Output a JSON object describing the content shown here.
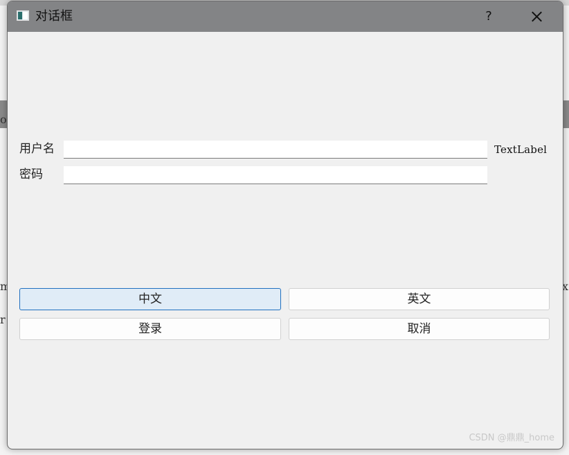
{
  "dialog": {
    "title": "对话框",
    "help_label": "?",
    "close_icon": "close-icon"
  },
  "form": {
    "username_label": "用户名",
    "username_value": "",
    "password_label": "密码",
    "password_value": "",
    "text_label": "TextLabel"
  },
  "buttons": {
    "chinese": "中文",
    "english": "英文",
    "login": "登录",
    "cancel": "取消"
  },
  "background_fragments": {
    "left_top": "o",
    "left_mid": "m",
    "left_low": "r",
    "right_mid": "x"
  },
  "watermark": "CSDN @鼎鼎_home",
  "colors": {
    "titlebar": "#838486",
    "focused_button_bg": "#e0ecf7",
    "focused_button_border": "#1f6fbf"
  }
}
